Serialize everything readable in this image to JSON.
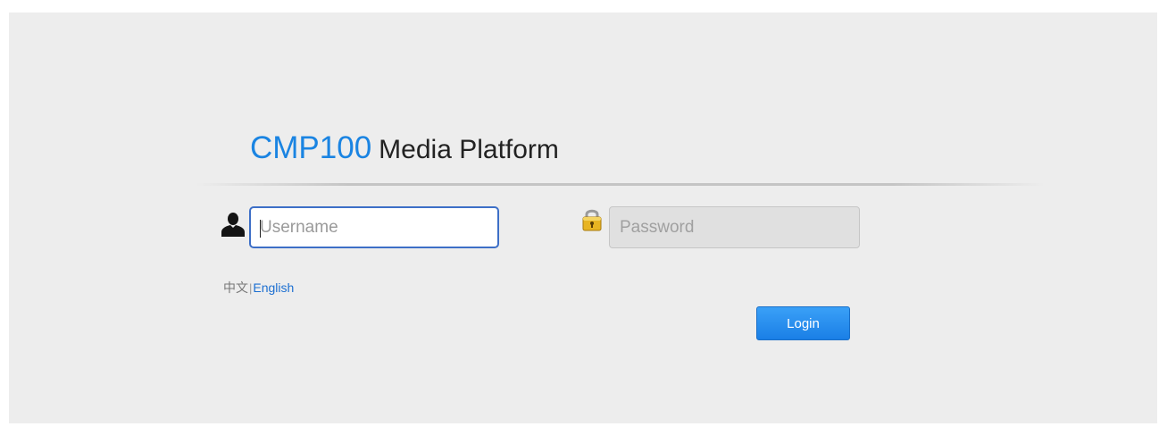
{
  "brand": {
    "product": "CMP100",
    "platform": "Media Platform"
  },
  "login_form": {
    "username": {
      "value": "",
      "placeholder": "Username",
      "icon": "user-icon"
    },
    "password": {
      "value": "",
      "placeholder": "Password",
      "icon": "lock-icon"
    },
    "login_label": "Login"
  },
  "language": {
    "chinese_label": "中文",
    "separator": "|",
    "english_label": "English",
    "selected": "English"
  },
  "colors": {
    "brand_accent": "#1a84e2",
    "button": "#2a8ff0",
    "link": "#1c6fd1",
    "background": "#ededed"
  }
}
